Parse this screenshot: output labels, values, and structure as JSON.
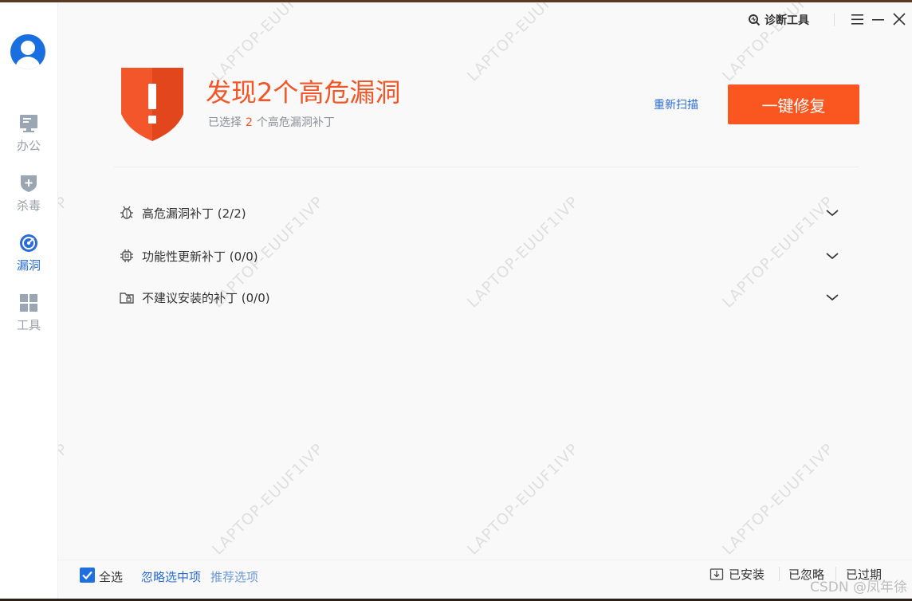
{
  "titlebar": {
    "diag_label": "诊断工具"
  },
  "sidebar": {
    "items": [
      {
        "label": "办公",
        "icon": "monitor-icon",
        "active": false
      },
      {
        "label": "杀毒",
        "icon": "shield-plus-icon",
        "active": false
      },
      {
        "label": "漏洞",
        "icon": "radar-icon",
        "active": true
      },
      {
        "label": "工具",
        "icon": "grid-icon",
        "active": false
      }
    ]
  },
  "header": {
    "title": "发现2个高危漏洞",
    "sub_prefix": "已选择",
    "sub_count": "2",
    "sub_suffix": "个高危漏洞补丁",
    "rescan_label": "重新扫描",
    "fix_label": "一键修复"
  },
  "patch_groups": [
    {
      "label": "高危漏洞补丁 (2/2)",
      "icon": "bug-icon"
    },
    {
      "label": "功能性更新补丁 (0/0)",
      "icon": "chip-icon"
    },
    {
      "label": "不建议安装的补丁 (0/0)",
      "icon": "folder-lock-icon"
    }
  ],
  "footer": {
    "select_all_label": "全选",
    "select_all_checked": true,
    "ignore_selected_label": "忽略选中项",
    "recommend_label": "推荐选项",
    "installed_label": "已安装",
    "ignored_label": "已忽略",
    "expired_label": "已过期"
  },
  "watermark": "LAPTOP-EUUF1IVP",
  "credit": "CSDN @凤年徐",
  "colors": {
    "accent_orange": "#fa5720",
    "headline_orange": "#f25627",
    "link_blue": "#2b6cd8",
    "checkbox_blue": "#1f6fe0"
  }
}
